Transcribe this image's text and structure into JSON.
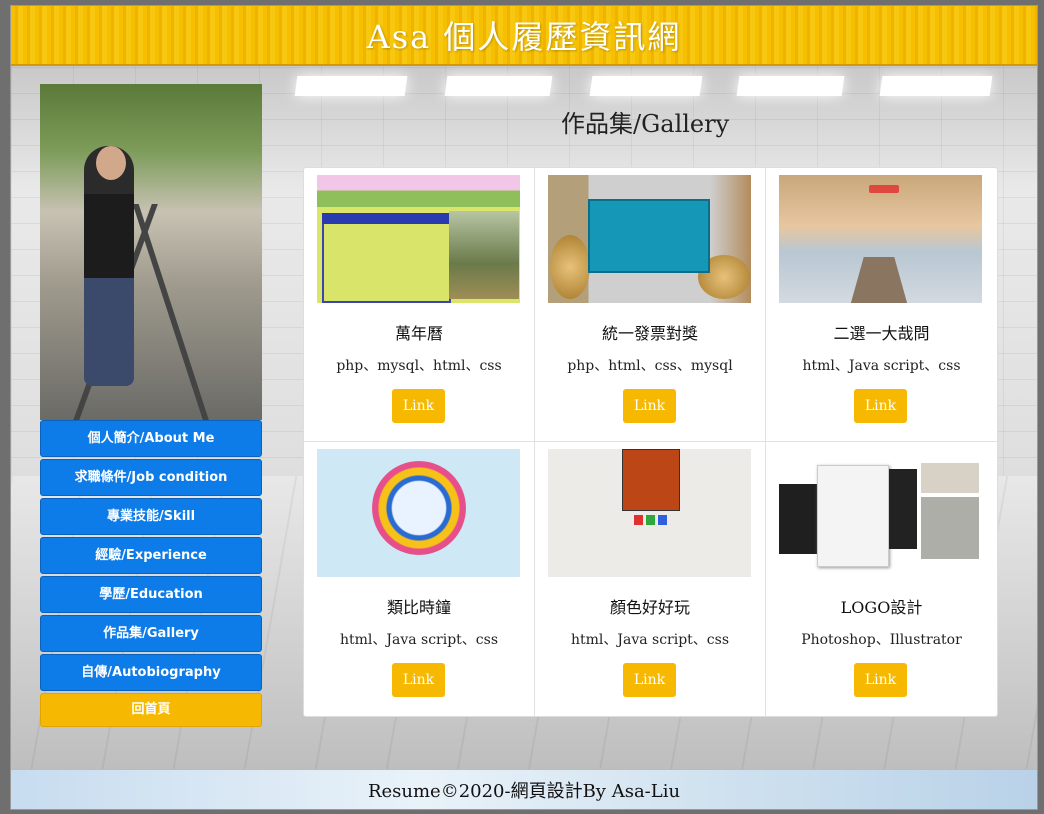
{
  "header": {
    "title": "Asa 個人履歷資訊網"
  },
  "menu": {
    "items": [
      {
        "label": "個人簡介/About Me"
      },
      {
        "label": "求職條件/Job condition"
      },
      {
        "label": "專業技能/Skill"
      },
      {
        "label": "經驗/Experience"
      },
      {
        "label": "學歷/Education"
      },
      {
        "label": "作品集/Gallery"
      },
      {
        "label": "自傳/Autobiography"
      }
    ],
    "home_label": "回首頁"
  },
  "gallery": {
    "title": "作品集/Gallery",
    "cards": [
      {
        "title": "萬年曆",
        "tech": "php、mysql、html、css",
        "link": "Link",
        "thumb": "calendar-thumb"
      },
      {
        "title": "統一發票對獎",
        "tech": "php、html、css、mysql",
        "link": "Link",
        "thumb": "receipt-thumb"
      },
      {
        "title": "二選一大哉問",
        "tech": "html、Java script、css",
        "link": "Link",
        "thumb": "vote-thumb"
      },
      {
        "title": "類比時鐘",
        "tech": "html、Java script、css",
        "link": "Link",
        "thumb": "clock-thumb"
      },
      {
        "title": "顏色好好玩",
        "tech": "html、Java script、css",
        "link": "Link",
        "thumb": "color-thumb"
      },
      {
        "title": "LOGO設計",
        "tech": "Photoshop、Illustrator",
        "link": "Link",
        "thumb": "logo-thumb"
      }
    ]
  },
  "footer": {
    "text": "Resume©2020-網頁設計By Asa-Liu"
  },
  "colors": {
    "header": "#f6c000",
    "menu": "#0d7be8",
    "home": "#f6b800",
    "link_button": "#f6b800"
  }
}
